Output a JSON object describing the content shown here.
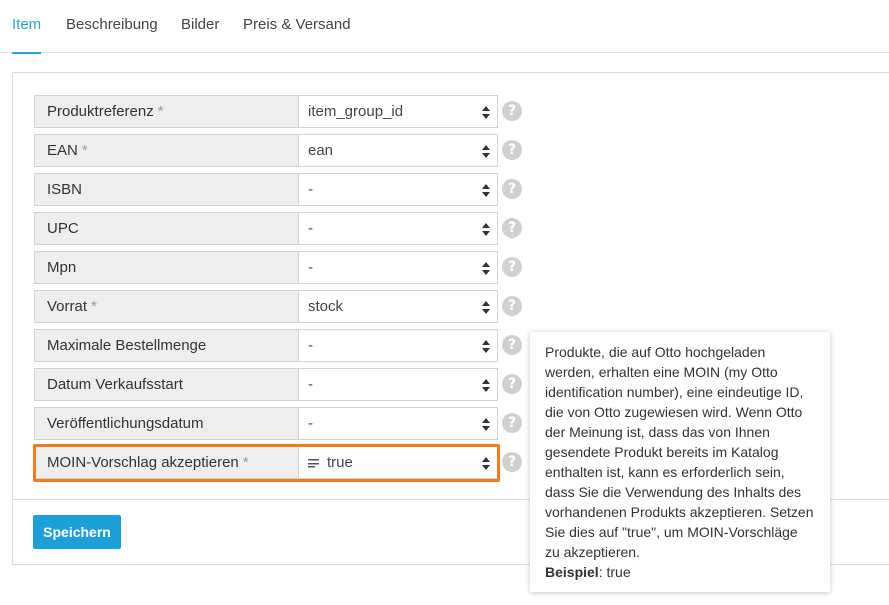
{
  "tabs": [
    {
      "label": "Item",
      "active": true
    },
    {
      "label": "Beschreibung",
      "active": false
    },
    {
      "label": "Bilder",
      "active": false
    },
    {
      "label": "Preis & Versand",
      "active": false
    }
  ],
  "form": {
    "rows": [
      {
        "label": "Produktreferenz",
        "required": "*",
        "value": "item_group_id"
      },
      {
        "label": "EAN",
        "required": "*",
        "value": "ean"
      },
      {
        "label": "ISBN",
        "required": "",
        "value": "-"
      },
      {
        "label": "UPC",
        "required": "",
        "value": "-"
      },
      {
        "label": "Mpn",
        "required": "",
        "value": "-"
      },
      {
        "label": "Vorrat",
        "required": "*",
        "value": "stock"
      },
      {
        "label": "Maximale Bestellmenge",
        "required": "",
        "value": "-"
      },
      {
        "label": "Datum Verkaufsstart",
        "required": "",
        "value": "-"
      },
      {
        "label": "Veröffentlichungsdatum",
        "required": "",
        "value": "-"
      },
      {
        "label": "MOIN-Vorschlag akzeptieren",
        "required": "*",
        "value": "true",
        "icon": "list-icon",
        "highlighted": true
      }
    ],
    "help_symbol": "?",
    "save_label": "Speichern"
  },
  "tooltip": {
    "text": "Produkte, die auf Otto hochgeladen werden, erhalten eine MOIN (my Otto identification number), eine eindeutige ID, die von Otto zugewiesen wird. Wenn Otto der Meinung ist, dass das von Ihnen gesendete Produkt bereits im Katalog enthalten ist, kann es erforderlich sein, dass Sie die Verwendung des Inhalts des vorhandenen Produkts akzeptieren. Setzen Sie dies auf \"true\", um MOIN-Vorschläge zu akzeptieren.",
    "example_label": "Beispiel",
    "example_value": "true"
  },
  "colors": {
    "accent": "#2aa4d5",
    "button": "#1f9fd8",
    "highlight": "#f07c22"
  }
}
